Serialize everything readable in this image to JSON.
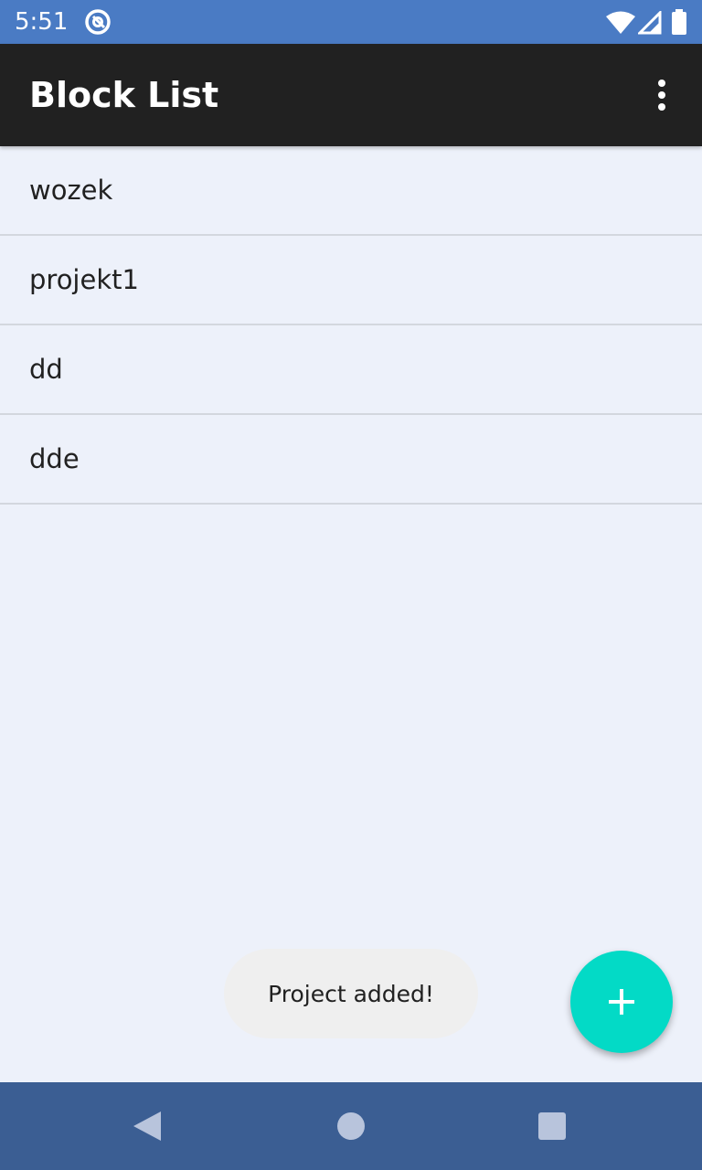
{
  "status_bar": {
    "time": "5:51",
    "color": "#4a7bc4",
    "icons": [
      "app-notification-icon",
      "wifi-icon",
      "cell-signal-icon",
      "battery-icon"
    ]
  },
  "app_bar": {
    "title": "Block List",
    "color": "#212121",
    "menu_icon": "more-vert-icon"
  },
  "list": {
    "items": [
      {
        "label": "wozek"
      },
      {
        "label": "projekt1"
      },
      {
        "label": "dd"
      },
      {
        "label": "dde"
      }
    ]
  },
  "toast": {
    "message": "Project added!"
  },
  "fab": {
    "icon": "add-icon",
    "color": "#03dac6"
  },
  "nav_bar": {
    "color": "#3b5e93",
    "icons": [
      "back-icon",
      "home-icon",
      "recents-icon"
    ]
  }
}
